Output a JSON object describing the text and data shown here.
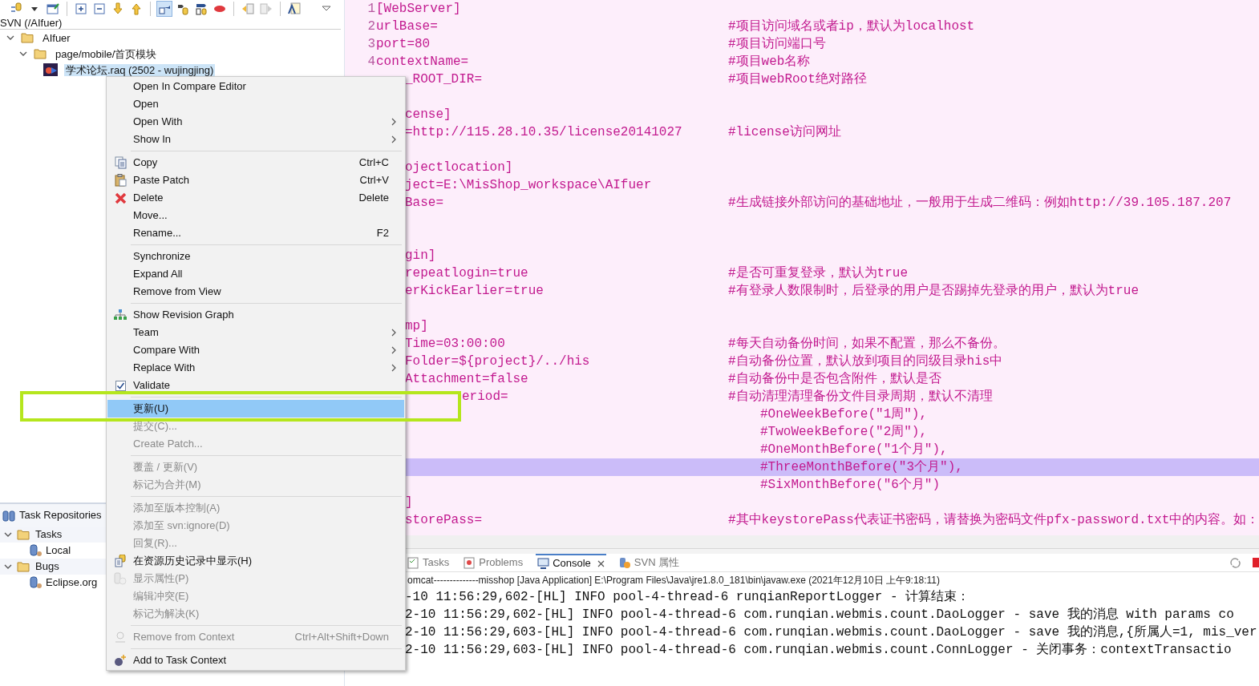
{
  "explorer": {
    "title": "SVN (/AIfuer)",
    "tree": [
      {
        "label": "AIfuer",
        "expanded": true,
        "selected": false,
        "children": [
          {
            "label": "page/mobile/首页模块",
            "expanded": true,
            "selected": false,
            "children": [
              {
                "label": "学术论坛.raq (2502 - wujingjing)",
                "selected": true
              }
            ]
          }
        ]
      }
    ]
  },
  "task_repositories": {
    "title": "Task Repositories",
    "items": [
      {
        "label": "Tasks",
        "expanded": true,
        "children": [
          {
            "label": "Local"
          }
        ]
      },
      {
        "label": "Bugs",
        "expanded": true,
        "children": [
          {
            "label": "Eclipse.org"
          }
        ]
      }
    ]
  },
  "editor": {
    "lines": [
      {
        "kind": "code",
        "number": "1",
        "code": "[WebServer]"
      },
      {
        "kind": "code",
        "number": "2",
        "code": "urlBase=",
        "comment": "#项目访问域名或者ip，默认为localhost"
      },
      {
        "kind": "code",
        "number": "3",
        "code": "port=80",
        "comment": "#项目访问端口号"
      },
      {
        "kind": "code",
        "number": "4",
        "code": "contextName=",
        "comment": "#项目web名称"
      },
      {
        "kind": "code",
        "code": "_ROOT_DIR=",
        "comment": "#项目webRoot绝对路径",
        "cut": true
      },
      {
        "kind": "blank"
      },
      {
        "kind": "code",
        "code": "cense]",
        "cut": true
      },
      {
        "kind": "code",
        "code": "=http://115.28.10.35/license20141027",
        "comment": "#license访问网址",
        "cut": true
      },
      {
        "kind": "blank"
      },
      {
        "kind": "code",
        "code": "ojectlocation]",
        "cut": true
      },
      {
        "kind": "code",
        "code": "ject=E:\\MisShop_workspace\\AIfuer",
        "cut": true
      },
      {
        "kind": "code",
        "code": "Base=",
        "comment": "#生成链接外部访问的基础地址，一般用于生成二维码：例如http://39.105.187.207",
        "cut": true
      },
      {
        "kind": "blank"
      },
      {
        "kind": "blank"
      },
      {
        "kind": "code",
        "code": "gin]",
        "cut": true
      },
      {
        "kind": "code",
        "code": "repeatlogin=true",
        "comment": "#是否可重复登录，默认为true",
        "cut": true
      },
      {
        "kind": "code",
        "code": "erKickEarlier=true",
        "comment": "#有登录人数限制时，后登录的用户是否踢掉先登录的用户，默认为true",
        "cut": true
      },
      {
        "kind": "blank"
      },
      {
        "kind": "code",
        "code": "mp]",
        "cut": true
      },
      {
        "kind": "code",
        "code": "Time=03:00:00",
        "comment": "#每天自动备份时间，如果不配置，那么不备份。",
        "cut": true
      },
      {
        "kind": "code",
        "code": "Folder=${project}/../his",
        "comment": "#自动备份位置，默认放到项目的同级目录his中",
        "cut": true
      },
      {
        "kind": "code",
        "code": "Attachment=false",
        "comment": "#自动备份中是否包含附件，默认是否",
        "cut": true
      },
      {
        "kind": "code",
        "code": "eriod=",
        "comment": "#自动清理清理备份文件目录周期，默认不清理",
        "cut": true,
        "covered": true
      },
      {
        "kind": "continuation",
        "comment": "#OneWeekBefore(\"1周\"),"
      },
      {
        "kind": "continuation",
        "comment": "#TwoWeekBefore(\"2周\"),"
      },
      {
        "kind": "continuation",
        "comment": "#OneMonthBefore(\"1个月\"),"
      },
      {
        "kind": "continuation",
        "comment": "#ThreeMonthBefore(\"3个月\"),",
        "highlighted": true
      },
      {
        "kind": "continuation",
        "comment": "#SixMonthBefore(\"6个月\")"
      },
      {
        "kind": "code",
        "code": "]",
        "cut": true
      },
      {
        "kind": "code",
        "code": "storePass=",
        "comment": "#其中keystorePass代表证书密码，请替换为密码文件pfx-password.txt中的内容。如：",
        "cut": true
      }
    ]
  },
  "console": {
    "tabs": [
      {
        "label": "Tasks",
        "selected": false
      },
      {
        "label": "Problems",
        "selected": false
      },
      {
        "label": "Console",
        "selected": true
      },
      {
        "label": "SVN 属性",
        "selected": false
      }
    ],
    "description": "omcat--------------misshop [Java Application] E:\\Program Files\\Java\\jre1.8.0_181\\bin\\javaw.exe (2021年12月10日 上午9:18:11)",
    "lines": [
      "-10 11:56:29,602-[HL] INFO pool-4-thread-6 runqianReportLogger - 计算结束：",
      "2-10 11:56:29,602-[HL] INFO pool-4-thread-6 com.runqian.webmis.count.DaoLogger - save 我的消息 with params co",
      "2-10 11:56:29,603-[HL] INFO pool-4-thread-6 com.runqian.webmis.count.DaoLogger - save 我的消息,{所属人=1, mis_ver",
      "2-10 11:56:29,603-[HL] INFO pool-4-thread-6 com.runqian.webmis.count.ConnLogger - 关闭事务：contextTransactio"
    ]
  },
  "context_menu": {
    "items": [
      {
        "kind": "item",
        "label": "Open In Compare Editor",
        "submenu": false,
        "disabled": false,
        "selected": false
      },
      {
        "kind": "item",
        "label": "Open",
        "submenu": false,
        "disabled": false,
        "selected": false
      },
      {
        "kind": "item",
        "label": "Open With",
        "submenu": true,
        "disabled": false,
        "selected": false
      },
      {
        "kind": "item",
        "label": "Show In",
        "submenu": true,
        "disabled": false,
        "selected": false
      },
      {
        "kind": "separator"
      },
      {
        "kind": "item",
        "label": "Copy",
        "shortcut": "Ctrl+C",
        "submenu": false,
        "disabled": false,
        "selected": false
      },
      {
        "kind": "item",
        "label": "Paste Patch",
        "shortcut": "Ctrl+V",
        "submenu": false,
        "disabled": false,
        "selected": false
      },
      {
        "kind": "item",
        "label": "Delete",
        "shortcut": "Delete",
        "submenu": false,
        "disabled": false,
        "selected": false
      },
      {
        "kind": "item",
        "label": "Move...",
        "submenu": false,
        "disabled": false,
        "selected": false
      },
      {
        "kind": "item",
        "label": "Rename...",
        "shortcut": "F2",
        "submenu": false,
        "disabled": false,
        "selected": false
      },
      {
        "kind": "separator"
      },
      {
        "kind": "item",
        "label": "Synchronize",
        "submenu": false,
        "disabled": false,
        "selected": false
      },
      {
        "kind": "item",
        "label": "Expand All",
        "submenu": false,
        "disabled": false,
        "selected": false
      },
      {
        "kind": "item",
        "label": "Remove from View",
        "submenu": false,
        "disabled": false,
        "selected": false
      },
      {
        "kind": "separator"
      },
      {
        "kind": "item",
        "label": "Show Revision Graph",
        "submenu": false,
        "disabled": false,
        "selected": false
      },
      {
        "kind": "item",
        "label": "Team",
        "submenu": true,
        "disabled": false,
        "selected": false
      },
      {
        "kind": "item",
        "label": "Compare With",
        "submenu": true,
        "disabled": false,
        "selected": false
      },
      {
        "kind": "item",
        "label": "Replace With",
        "submenu": true,
        "disabled": false,
        "selected": false
      },
      {
        "kind": "item",
        "label": "Validate",
        "checked": true,
        "submenu": false,
        "disabled": false,
        "selected": false
      },
      {
        "kind": "separator"
      },
      {
        "kind": "item",
        "label": "更新(U)",
        "submenu": false,
        "disabled": false,
        "selected": true
      },
      {
        "kind": "item",
        "label": "提交(C)...",
        "submenu": false,
        "disabled": true,
        "selected": false
      },
      {
        "kind": "item",
        "label": "Create Patch...",
        "submenu": false,
        "disabled": true,
        "selected": false
      },
      {
        "kind": "separator"
      },
      {
        "kind": "item",
        "label": "覆盖 / 更新(V)",
        "submenu": false,
        "disabled": true,
        "selected": false
      },
      {
        "kind": "item",
        "label": "标记为合并(M)",
        "submenu": false,
        "disabled": true,
        "selected": false
      },
      {
        "kind": "separator"
      },
      {
        "kind": "item",
        "label": "添加至版本控制(A)",
        "submenu": false,
        "disabled": true,
        "selected": false
      },
      {
        "kind": "item",
        "label": "添加至 svn:ignore(D)",
        "submenu": false,
        "disabled": true,
        "selected": false
      },
      {
        "kind": "item",
        "label": "回复(R)...",
        "submenu": false,
        "disabled": true,
        "selected": false
      },
      {
        "kind": "item",
        "label": "在资源历史记录中显示(H)",
        "submenu": false,
        "disabled": false,
        "selected": false
      },
      {
        "kind": "item",
        "label": "显示属性(P)",
        "submenu": false,
        "disabled": true,
        "selected": false
      },
      {
        "kind": "item",
        "label": "编辑冲突(E)",
        "submenu": false,
        "disabled": true,
        "selected": false
      },
      {
        "kind": "item",
        "label": "标记为解决(K)",
        "submenu": false,
        "disabled": true,
        "selected": false
      },
      {
        "kind": "separator"
      },
      {
        "kind": "item",
        "label": "Remove from Context",
        "shortcut": "Ctrl+Alt+Shift+Down",
        "submenu": false,
        "disabled": true,
        "selected": false
      },
      {
        "kind": "separator"
      },
      {
        "kind": "item",
        "label": "Add to Task Context",
        "submenu": false,
        "disabled": false,
        "selected": false
      }
    ]
  }
}
